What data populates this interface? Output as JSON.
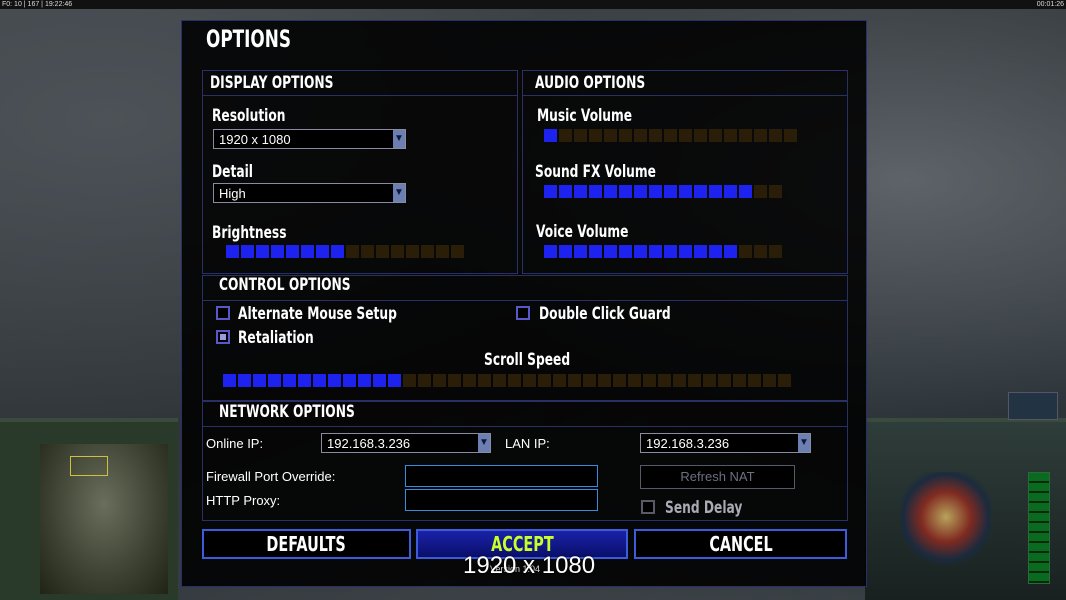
{
  "hud": {
    "top_left": "F0: 10 | 167 | 19:22:46",
    "top_left_highlight": "167",
    "top_right": "00:01:26"
  },
  "dialog": {
    "title": "OPTIONS",
    "display": {
      "header": "DISPLAY OPTIONS",
      "resolution_label": "Resolution",
      "resolution_value": "1920 x 1080",
      "detail_label": "Detail",
      "detail_value": "High",
      "brightness_label": "Brightness",
      "brightness_level": 8,
      "brightness_max": 16
    },
    "audio": {
      "header": "AUDIO OPTIONS",
      "music_label": "Music Volume",
      "music_level": 1,
      "music_max": 17,
      "sfx_label": "Sound FX Volume",
      "sfx_level": 14,
      "sfx_max": 16,
      "voice_label": "Voice Volume",
      "voice_level": 13,
      "voice_max": 16
    },
    "control": {
      "header": "CONTROL OPTIONS",
      "alt_mouse_label": "Alternate Mouse Setup",
      "alt_mouse_checked": false,
      "double_click_label": "Double Click Guard",
      "double_click_checked": false,
      "retaliation_label": "Retaliation",
      "retaliation_checked": true,
      "scroll_label": "Scroll Speed",
      "scroll_level": 12,
      "scroll_max": 38
    },
    "network": {
      "header": "NETWORK OPTIONS",
      "online_ip_label": "Online IP:",
      "online_ip_value": "192.168.3.236",
      "lan_ip_label": "LAN IP:",
      "lan_ip_value": "192.168.3.236",
      "firewall_label": "Firewall Port Override:",
      "firewall_value": "",
      "proxy_label": "HTTP Proxy:",
      "proxy_value": "",
      "refresh_nat_label": "Refresh NAT",
      "send_delay_label": "Send Delay",
      "send_delay_checked": false
    },
    "buttons": {
      "defaults": "DEFAULTS",
      "accept": "ACCEPT",
      "cancel": "CANCEL"
    },
    "version": "Version 1.04"
  },
  "overlay_resolution": "1920 x 1080",
  "colors": {
    "segment_on": "#1e22ee",
    "segment_off": "#2a1e08",
    "accept_text": "#c8ff2a",
    "border": "#2a2f66"
  }
}
